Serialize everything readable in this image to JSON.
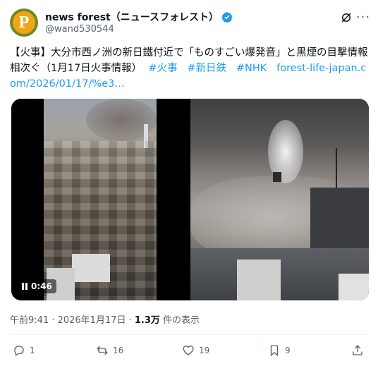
{
  "author": {
    "display_name": "news forest（ニュースフォレスト）",
    "handle": "@wand530544",
    "avatar_letter": "P"
  },
  "tweet": {
    "text_main": "【火事】大分市西ノ洲の新日鐵付近で「ものすごい爆発音」と黒煙の目撃情報相次ぐ（1月17日火事情報）",
    "hashtags": [
      "#火事",
      "#新日鉄",
      "#NHK"
    ],
    "link": "forest-life-japan.com/2026/01/17/%e3…"
  },
  "media": {
    "video_time": "0:46"
  },
  "meta": {
    "timestamp": "午前9:41 · 2026年1月17日 · ",
    "views_count": "1.3万",
    "views_label": " 件の表示"
  },
  "actions": {
    "replies": "1",
    "reposts": "16",
    "likes": "19",
    "bookmarks": "9"
  },
  "colors": {
    "link": "#1d9bf0",
    "secondary_text": "#536471",
    "verified": "#1d9bf0"
  }
}
